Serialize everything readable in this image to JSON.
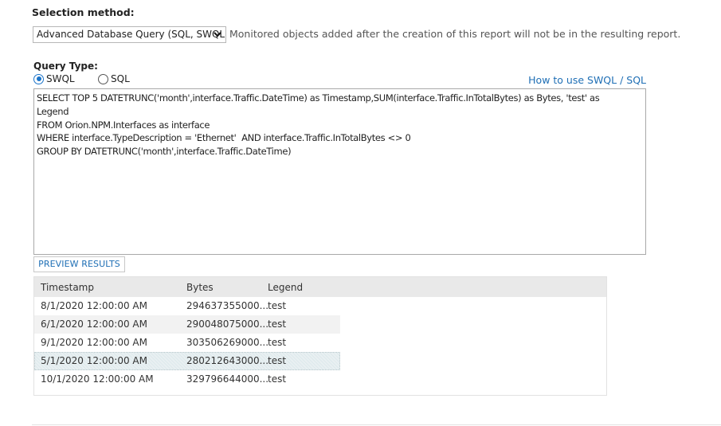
{
  "selection": {
    "title": "Selection method:",
    "selected_value": "Advanced Database Query (SQL, SWQL)",
    "note": "Monitored objects added after the creation of this report will not be in the resulting report."
  },
  "query_type": {
    "title": "Query Type:",
    "options": [
      {
        "label": "SWQL",
        "selected": true
      },
      {
        "label": "SQL",
        "selected": false
      }
    ],
    "help_link": "How to use SWQL / SQL"
  },
  "query_text": "SELECT TOP 5 DATETRUNC('month',interface.Traffic.DateTime) as Timestamp,SUM(interface.Traffic.InTotalBytes) as Bytes, 'test' as\nLegend\nFROM Orion.NPM.Interfaces as interface\nWHERE interface.TypeDescription = 'Ethernet'  AND interface.Traffic.InTotalBytes <> 0\nGROUP BY DATETRUNC('month',interface.Traffic.DateTime)",
  "preview_button": "PREVIEW RESULTS",
  "results": {
    "columns": [
      "Timestamp",
      "Bytes",
      "Legend"
    ],
    "rows": [
      {
        "timestamp": "8/1/2020 12:00:00 AM",
        "bytes": "294637355000...",
        "legend": "test"
      },
      {
        "timestamp": "6/1/2020 12:00:00 AM",
        "bytes": "290048075000...",
        "legend": "test"
      },
      {
        "timestamp": "9/1/2020 12:00:00 AM",
        "bytes": "303506269000...",
        "legend": "test"
      },
      {
        "timestamp": "5/1/2020 12:00:00 AM",
        "bytes": "280212643000...",
        "legend": "test"
      },
      {
        "timestamp": "10/1/2020 12:00:00 AM",
        "bytes": "329796644000...",
        "legend": "test"
      }
    ]
  },
  "colors": {
    "link": "#1f6fb5",
    "radio_accent": "#1a73c9",
    "header_bg": "#e9e9e9"
  }
}
